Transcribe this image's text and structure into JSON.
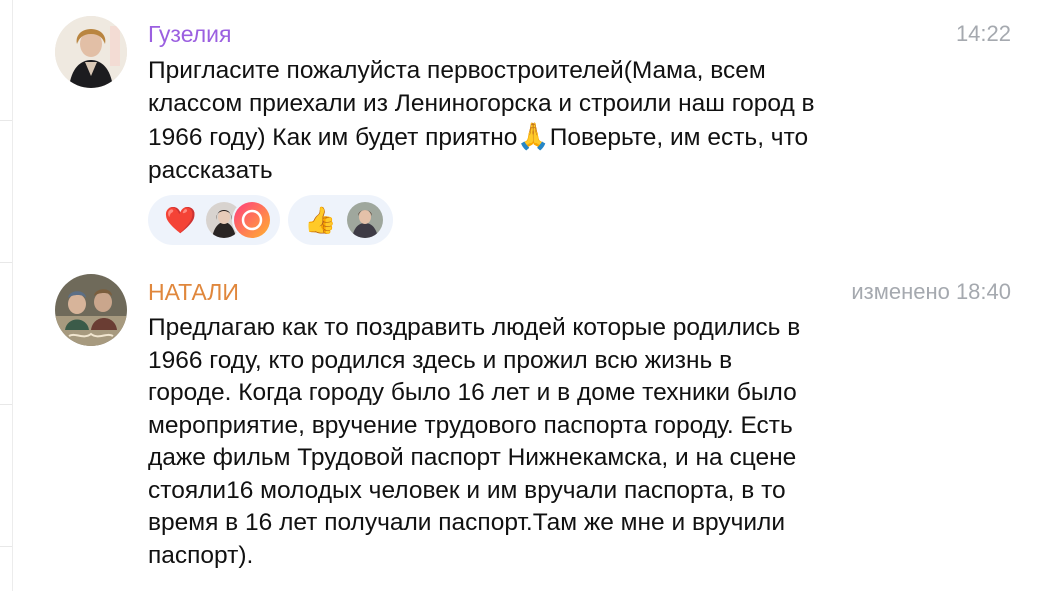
{
  "messages": [
    {
      "author": "Гузелия",
      "author_color": "#9b5fe0",
      "time": "14:22",
      "text_before_emoji": "Пригласите пожалуйста первостроителей(Мама, всем\nклассом приехали из Лениногорска и строили наш город в\n1966 году) Как им будет приятно",
      "inline_emoji": "🙏",
      "text_after_emoji": "Поверьте, им есть, что\nрассказать",
      "reactions": [
        {
          "emoji": "❤️",
          "icon": "heart-icon"
        },
        {
          "emoji": "👍",
          "icon": "thumbs-up-icon"
        }
      ]
    },
    {
      "author": "НАТАЛИ",
      "author_color": "#e0873c",
      "time": "изменено 18:40",
      "text": "Предлагаю как то поздравить людей которые родились в\n1966 году, кто родился здесь и прожил всю жизнь в\nгороде. Когда городу было 16 лет и в доме техники было\nмероприятие, вручение трудового паспорта городу. Есть\nдаже фильм Трудовой паспорт Нижнекамска, и на сцене\nстояли16 молодых человек и им  вручали паспорта, в то\nвремя в 16 лет получали паспорт.Там же мне и вручили\nпаспорт)."
    }
  ],
  "colors": {
    "accent_reaction_bg": "#eef3fb",
    "time_gray": "#a5a9af",
    "text": "#111111"
  }
}
